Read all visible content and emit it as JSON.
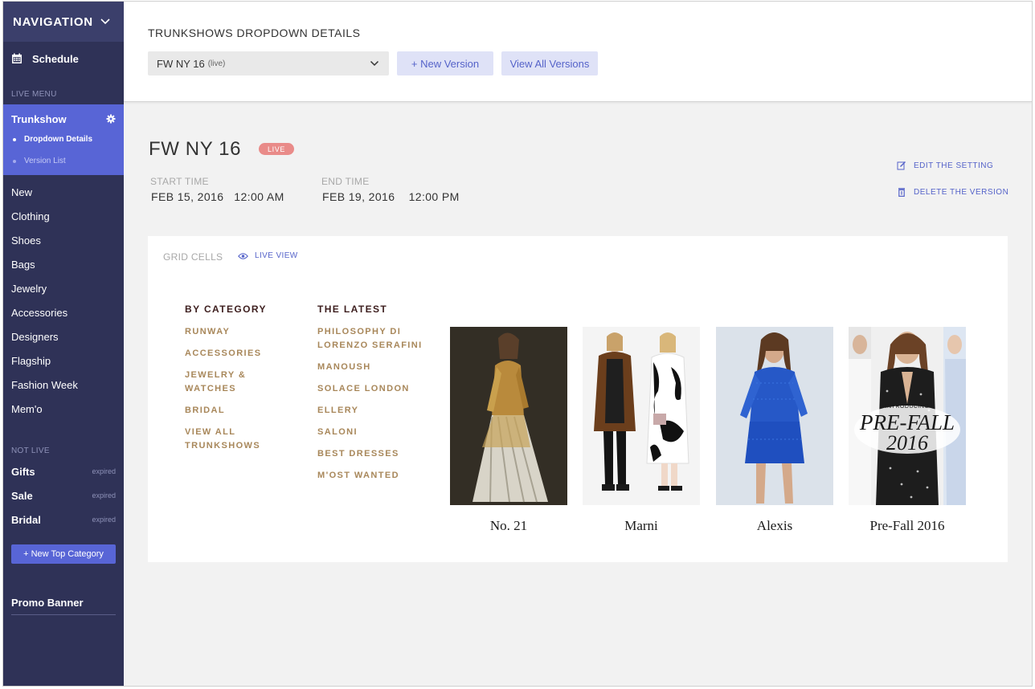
{
  "sidebar": {
    "nav_title": "NAVIGATION",
    "schedule_label": "Schedule",
    "live_menu_label": "LIVE MENU",
    "active_menu": {
      "label": "Trunkshow",
      "sub_items": [
        {
          "label": "Dropdown Details"
        },
        {
          "label": "Version List"
        }
      ]
    },
    "menu_items": [
      {
        "label": "New"
      },
      {
        "label": "Clothing"
      },
      {
        "label": "Shoes"
      },
      {
        "label": "Bags"
      },
      {
        "label": "Jewelry"
      },
      {
        "label": "Accessories"
      },
      {
        "label": "Designers"
      },
      {
        "label": "Flagship"
      },
      {
        "label": "Fashion Week"
      },
      {
        "label": "Mem'o"
      }
    ],
    "not_live_label": "NOT LIVE",
    "not_live_items": [
      {
        "label": "Gifts",
        "status": "expired"
      },
      {
        "label": "Sale",
        "status": "expired"
      },
      {
        "label": "Bridal",
        "status": "expired"
      }
    ],
    "new_top_category_label": "+ New Top Category",
    "promo_banner_label": "Promo Banner"
  },
  "header": {
    "title": "TRUNKSHOWS DROPDOWN DETAILS",
    "selected_version": "FW NY 16",
    "selected_version_tag": "(live)",
    "new_version_label": "+ New Version",
    "view_all_label": "View All Versions"
  },
  "version": {
    "title": "FW NY 16",
    "status_badge": "LIVE",
    "start_label": "START TIME",
    "start_value": "FEB 15, 2016   12:00 AM",
    "end_label": "END TIME",
    "end_value": "FEB 19, 2016    12:00 PM",
    "edit_label": "EDIT THE SETTING",
    "delete_label": "DELETE THE VERSION"
  },
  "grid": {
    "label": "GRID CELLS",
    "live_view_label": "LIVE VIEW",
    "by_category": {
      "heading": "BY CATEGORY",
      "links": [
        "RUNWAY",
        "ACCESSORIES",
        "JEWELRY & WATCHES",
        "BRIDAL",
        "VIEW ALL TRUNKSHOWS"
      ]
    },
    "the_latest": {
      "heading": "THE LATEST",
      "links": [
        "PHILOSOPHY DI LORENZO SERAFINI",
        "MANOUSH",
        "SOLACE LONDON",
        "ELLERY",
        "SALONI",
        "BEST DRESSES",
        "M'OST WANTED"
      ]
    },
    "tiles": [
      {
        "caption": "No. 21"
      },
      {
        "caption": "Marni"
      },
      {
        "caption": "Alexis"
      },
      {
        "caption": "Pre-Fall 2016",
        "overlay_intro": "INTRODUCING",
        "overlay_main": "PRE-FALL",
        "overlay_year": "2016"
      }
    ]
  },
  "colors": {
    "sidebar_bg": "#2f3257",
    "sidebar_header_bg": "#3b3f6b",
    "accent": "#5865d6",
    "link_blue": "#5563c9",
    "live_badge": "#e98b89",
    "category_heading": "#3d1e1e",
    "category_link": "#a8875a"
  }
}
